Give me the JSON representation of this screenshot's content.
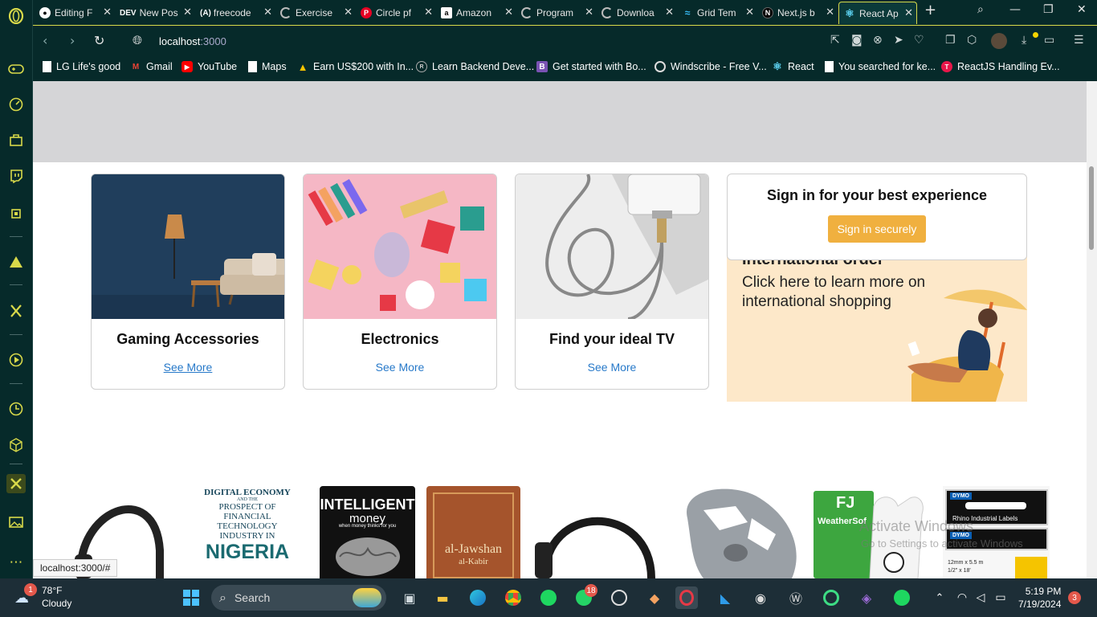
{
  "tabs": [
    {
      "title": "Editing F",
      "icon": "github-icon"
    },
    {
      "title": "New Pos",
      "icon": "dev-icon",
      "prefix": "DEV"
    },
    {
      "title": "freecode",
      "icon": "freecodecamp-icon",
      "prefix": "(A)"
    },
    {
      "title": "Exercise",
      "icon": "loading-icon"
    },
    {
      "title": "Circle pf",
      "icon": "pinterest-icon"
    },
    {
      "title": "Amazon",
      "icon": "amazon-icon"
    },
    {
      "title": "Program",
      "icon": "loading-icon"
    },
    {
      "title": "Downloa",
      "icon": "loading-icon"
    },
    {
      "title": "Grid Tem",
      "icon": "tailwind-icon"
    },
    {
      "title": "Next.js b",
      "icon": "nextjs-icon"
    },
    {
      "title": "React Ap",
      "icon": "react-icon",
      "active": true
    }
  ],
  "address": {
    "url_host": "localhost",
    "url_port": ":3000"
  },
  "bookmarks": [
    {
      "label": "LG Life's good"
    },
    {
      "label": "Gmail"
    },
    {
      "label": "YouTube"
    },
    {
      "label": "Maps"
    },
    {
      "label": "Earn US$200 with In..."
    },
    {
      "label": "Learn Backend Deve..."
    },
    {
      "label": "Get started with Bo..."
    },
    {
      "label": "Windscribe - Free V..."
    },
    {
      "label": "React"
    },
    {
      "label": "You searched for ke..."
    },
    {
      "label": "ReactJS Handling Ev..."
    }
  ],
  "cards": [
    {
      "title": "Gaming Accessories",
      "link": "See More"
    },
    {
      "title": "Electronics",
      "link": "See More"
    },
    {
      "title": "Find your ideal TV",
      "link": "See More"
    }
  ],
  "signin": {
    "heading": "Sign in for your best experience",
    "button": "Sign in securely"
  },
  "intl": {
    "title": "International order",
    "body": "Click here to learn more on international shopping"
  },
  "products": [
    {
      "name": "headphones-1"
    },
    {
      "name": "book-digital-economy",
      "lines": [
        "DIGITAL ECONOMY",
        "AND THE",
        "PROSPECT OF",
        "FINANCIAL",
        "TECHNOLOGY",
        "INDUSTRY IN",
        "NIGERIA"
      ]
    },
    {
      "name": "book-intelligent-money",
      "lines": [
        "INTELLIGENT",
        "money",
        "when money thinks for you"
      ]
    },
    {
      "name": "book-al-jawshan",
      "lines": [
        "al-Jawshan",
        "al-Kabir"
      ]
    },
    {
      "name": "headphones-2"
    },
    {
      "name": "bike-pedal-cleat"
    },
    {
      "name": "golf-glove",
      "lines": [
        "FJ",
        "WeatherSof"
      ]
    },
    {
      "name": "dymo-labels",
      "lines": [
        "DYMO",
        "Rhino Industrial Labels",
        "DYMO",
        "12mm x 5.5 m",
        "1/2\" x 18'"
      ]
    }
  ],
  "status_url": "localhost:3000/#",
  "watermark": {
    "line1": "Activate Windows",
    "line2": "Go to Settings to activate Windows"
  },
  "taskbar": {
    "weather_temp": "78°F",
    "weather_desc": "Cloudy",
    "weather_badge": "1",
    "search": "Search",
    "whatsapp_badge": "18",
    "time": "5:19 PM",
    "date": "7/19/2024",
    "notif_badge": "3"
  },
  "colors": {
    "browser_bg": "#062a2a",
    "accent": "#d8d94a",
    "link": "#2779c9",
    "signin_button": "#f0b03f",
    "banner_gray": "#d5d5d7",
    "taskbar": "#1d2e37"
  }
}
